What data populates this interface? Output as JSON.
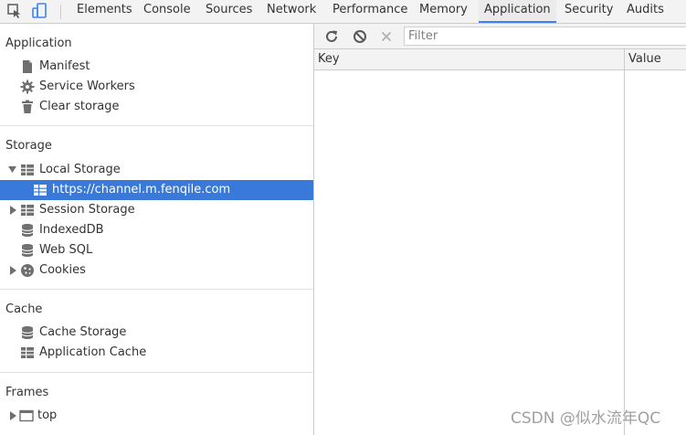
{
  "tabs": [
    {
      "label": "Elements"
    },
    {
      "label": "Console"
    },
    {
      "label": "Sources"
    },
    {
      "label": "Network"
    },
    {
      "label": "Performance"
    },
    {
      "label": "Memory"
    },
    {
      "label": "Application",
      "active": true
    },
    {
      "label": "Security"
    },
    {
      "label": "Audits"
    }
  ],
  "sidebar": {
    "application": {
      "title": "Application",
      "items": [
        {
          "label": "Manifest",
          "icon": "file-icon"
        },
        {
          "label": "Service Workers",
          "icon": "gear-icon"
        },
        {
          "label": "Clear storage",
          "icon": "trash-icon"
        }
      ]
    },
    "storage": {
      "title": "Storage",
      "local_storage": "Local Storage",
      "local_storage_child": "https://channel.m.fenqile.com",
      "session_storage": "Session Storage",
      "indexeddb": "IndexedDB",
      "websql": "Web SQL",
      "cookies": "Cookies"
    },
    "cache": {
      "title": "Cache",
      "cache_storage": "Cache Storage",
      "application_cache": "Application Cache"
    },
    "frames": {
      "title": "Frames",
      "top": "top"
    }
  },
  "main": {
    "filter_placeholder": "Filter",
    "columns": {
      "key": "Key",
      "value": "Value"
    }
  },
  "watermark": "CSDN @似水流年QC",
  "colors": {
    "selected_row": "#3879d9",
    "active_tab_underline": "#3e82f7"
  }
}
